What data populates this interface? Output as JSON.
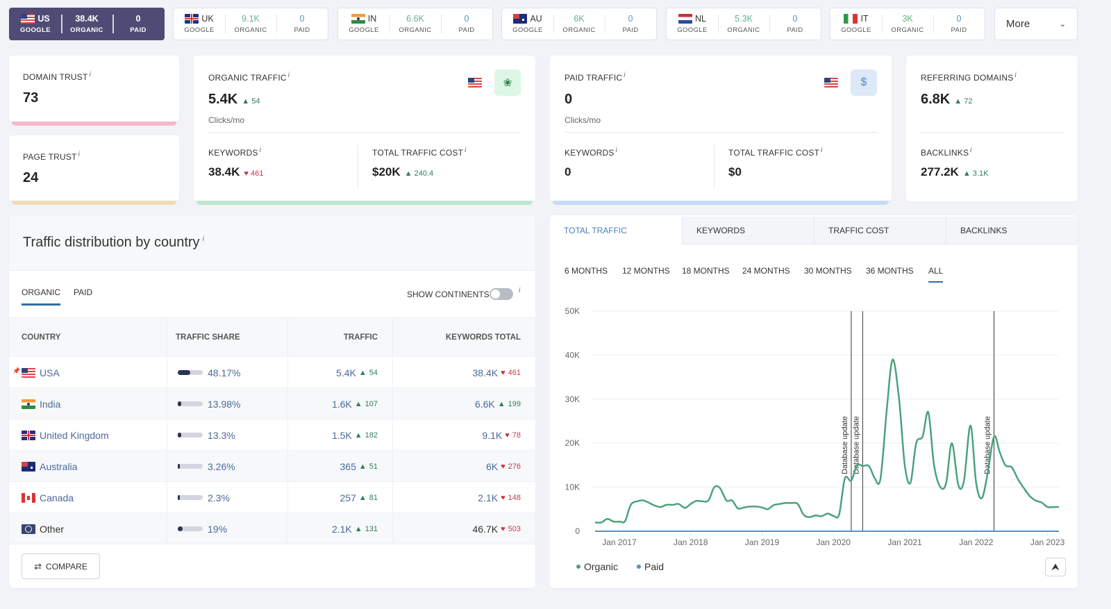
{
  "country_tabs": [
    {
      "code": "US",
      "engine": "GOOGLE",
      "organic": "38.4K",
      "organic_label": "ORGANIC",
      "paid": "0",
      "paid_label": "PAID",
      "active": true
    },
    {
      "code": "UK",
      "engine": "GOOGLE",
      "organic": "9.1K",
      "organic_label": "ORGANIC",
      "paid": "0",
      "paid_label": "PAID"
    },
    {
      "code": "IN",
      "engine": "GOOGLE",
      "organic": "6.6K",
      "organic_label": "ORGANIC",
      "paid": "0",
      "paid_label": "PAID"
    },
    {
      "code": "AU",
      "engine": "GOOGLE",
      "organic": "6K",
      "organic_label": "ORGANIC",
      "paid": "0",
      "paid_label": "PAID"
    },
    {
      "code": "NL",
      "engine": "GOOGLE",
      "organic": "5.3K",
      "organic_label": "ORGANIC",
      "paid": "0",
      "paid_label": "PAID"
    },
    {
      "code": "IT",
      "engine": "GOOGLE",
      "organic": "3K",
      "organic_label": "ORGANIC",
      "paid": "0",
      "paid_label": "PAID"
    }
  ],
  "more_label": "More",
  "domain_trust": {
    "label": "DOMAIN TRUST",
    "value": "73"
  },
  "page_trust": {
    "label": "PAGE TRUST",
    "value": "24"
  },
  "organic_traffic": {
    "label": "ORGANIC TRAFFIC",
    "value": "5.4K",
    "delta": "54",
    "unit": "Clicks/mo",
    "keywords_label": "KEYWORDS",
    "keywords": "38.4K",
    "keywords_delta": "461",
    "cost_label": "TOTAL TRAFFIC COST",
    "cost": "$20K",
    "cost_delta": "240.4"
  },
  "paid_traffic": {
    "label": "PAID TRAFFIC",
    "value": "0",
    "unit": "Clicks/mo",
    "keywords_label": "KEYWORDS",
    "keywords": "0",
    "cost_label": "TOTAL TRAFFIC COST",
    "cost": "$0",
    "icon": "$"
  },
  "referring": {
    "label": "REFERRING DOMAINS",
    "value": "6.8K",
    "delta": "72",
    "backlinks_label": "BACKLINKS",
    "backlinks": "277.2K",
    "backlinks_delta": "3.1K"
  },
  "distribution": {
    "title": "Traffic distribution by country",
    "tabs": [
      "ORGANIC",
      "PAID"
    ],
    "show_continents": "SHOW CONTINENTS",
    "columns": [
      "COUNTRY",
      "TRAFFIC SHARE",
      "TRAFFIC",
      "KEYWORDS TOTAL"
    ],
    "rows": [
      {
        "country": "USA",
        "share": "48.17%",
        "share_value": 48.17,
        "traffic": "5.4K",
        "traffic_delta": "54",
        "traffic_dir": "up",
        "keywords": "38.4K",
        "kw_delta": "461",
        "kw_dir": "down",
        "flag": "us",
        "pinned": true
      },
      {
        "country": "India",
        "share": "13.98%",
        "share_value": 13.98,
        "traffic": "1.6K",
        "traffic_delta": "107",
        "traffic_dir": "up",
        "keywords": "6.6K",
        "kw_delta": "199",
        "kw_dir": "up",
        "flag": "in"
      },
      {
        "country": "United Kingdom",
        "share": "13.3%",
        "share_value": 13.3,
        "traffic": "1.5K",
        "traffic_delta": "182",
        "traffic_dir": "up",
        "keywords": "9.1K",
        "kw_delta": "78",
        "kw_dir": "down",
        "flag": "uk"
      },
      {
        "country": "Australia",
        "share": "3.26%",
        "share_value": 3.26,
        "traffic": "365",
        "traffic_delta": "51",
        "traffic_dir": "up",
        "keywords": "6K",
        "kw_delta": "276",
        "kw_dir": "down",
        "flag": "au"
      },
      {
        "country": "Canada",
        "share": "2.3%",
        "share_value": 2.3,
        "traffic": "257",
        "traffic_delta": "81",
        "traffic_dir": "up",
        "keywords": "2.1K",
        "kw_delta": "148",
        "kw_dir": "down",
        "flag": "ca"
      },
      {
        "country": "Other",
        "share": "19%",
        "share_value": 19,
        "traffic": "2.1K",
        "traffic_delta": "131",
        "traffic_dir": "up",
        "keywords": "46.7K",
        "kw_delta": "503",
        "kw_dir": "down",
        "flag": "globe"
      }
    ],
    "compare_label": "COMPARE"
  },
  "chart_tabs": [
    "TOTAL TRAFFIC",
    "KEYWORDS",
    "TRAFFIC COST",
    "BACKLINKS"
  ],
  "ranges": [
    "6 MONTHS",
    "12 MONTHS",
    "18 MONTHS",
    "24 MONTHS",
    "30 MONTHS",
    "36 MONTHS",
    "ALL"
  ],
  "colors": {
    "organic": "#4aa27c",
    "paid": "#5b8fc8",
    "active_tab": "#4f4b74"
  },
  "chart_data": {
    "type": "line",
    "title": "Total traffic",
    "xlabel": "",
    "ylabel": "",
    "ylim": [
      0,
      50000
    ],
    "yticks": [
      "0",
      "10K",
      "20K",
      "30K",
      "40K",
      "50K"
    ],
    "xticks": [
      "Jan 2017",
      "Jan 2018",
      "Jan 2019",
      "Jan 2020",
      "Jan 2021",
      "Jan 2022",
      "Jan 2023"
    ],
    "legend": [
      "Organic",
      "Paid"
    ],
    "legend_position": "bottom-left",
    "grid": true,
    "annotations": [
      {
        "label": "Database update",
        "x": 2020.25
      },
      {
        "label": "Database update",
        "x": 2020.41
      },
      {
        "label": "Database update",
        "x": 2022.25
      }
    ],
    "series": [
      {
        "name": "Organic",
        "x": [
          2016.66,
          2016.75,
          2016.83,
          2016.92,
          2017.0,
          2017.08,
          2017.16,
          2017.25,
          2017.33,
          2017.41,
          2017.5,
          2017.58,
          2017.66,
          2017.75,
          2017.83,
          2017.92,
          2018.0,
          2018.08,
          2018.16,
          2018.25,
          2018.33,
          2018.41,
          2018.5,
          2018.58,
          2018.66,
          2018.75,
          2018.83,
          2018.92,
          2019.0,
          2019.08,
          2019.16,
          2019.25,
          2019.33,
          2019.41,
          2019.5,
          2019.58,
          2019.66,
          2019.75,
          2019.83,
          2019.92,
          2020.0,
          2020.08,
          2020.16,
          2020.25,
          2020.33,
          2020.41,
          2020.5,
          2020.58,
          2020.66,
          2020.75,
          2020.83,
          2020.92,
          2021.0,
          2021.08,
          2021.16,
          2021.25,
          2021.33,
          2021.41,
          2021.5,
          2021.58,
          2021.66,
          2021.75,
          2021.83,
          2021.92,
          2022.0,
          2022.08,
          2022.16,
          2022.25,
          2022.33,
          2022.41,
          2022.5,
          2022.58,
          2022.66,
          2022.75,
          2022.83,
          2022.92,
          2023.0,
          2023.08,
          2023.16
        ],
        "values": [
          2000,
          2000,
          2800,
          2200,
          2200,
          2300,
          6000,
          6800,
          7000,
          6500,
          5800,
          5500,
          6000,
          6000,
          6200,
          5300,
          6200,
          6900,
          6800,
          7000,
          10000,
          9800,
          7000,
          7000,
          5200,
          5400,
          5600,
          5600,
          5400,
          5000,
          5900,
          6200,
          6400,
          6400,
          6200,
          3800,
          3200,
          3600,
          3400,
          4000,
          3500,
          3800,
          12000,
          11500,
          15000,
          14800,
          14800,
          12000,
          12000,
          28000,
          39000,
          30000,
          15000,
          11000,
          20000,
          21500,
          27000,
          15000,
          10000,
          11000,
          20000,
          10500,
          11500,
          24000,
          11000,
          7500,
          13000,
          21500,
          18000,
          15000,
          14500,
          12000,
          10000,
          8000,
          7000,
          6500,
          5500,
          5500,
          5500
        ]
      },
      {
        "name": "Paid",
        "x": [
          2016.66,
          2023.16
        ],
        "values": [
          0,
          0
        ]
      }
    ]
  }
}
